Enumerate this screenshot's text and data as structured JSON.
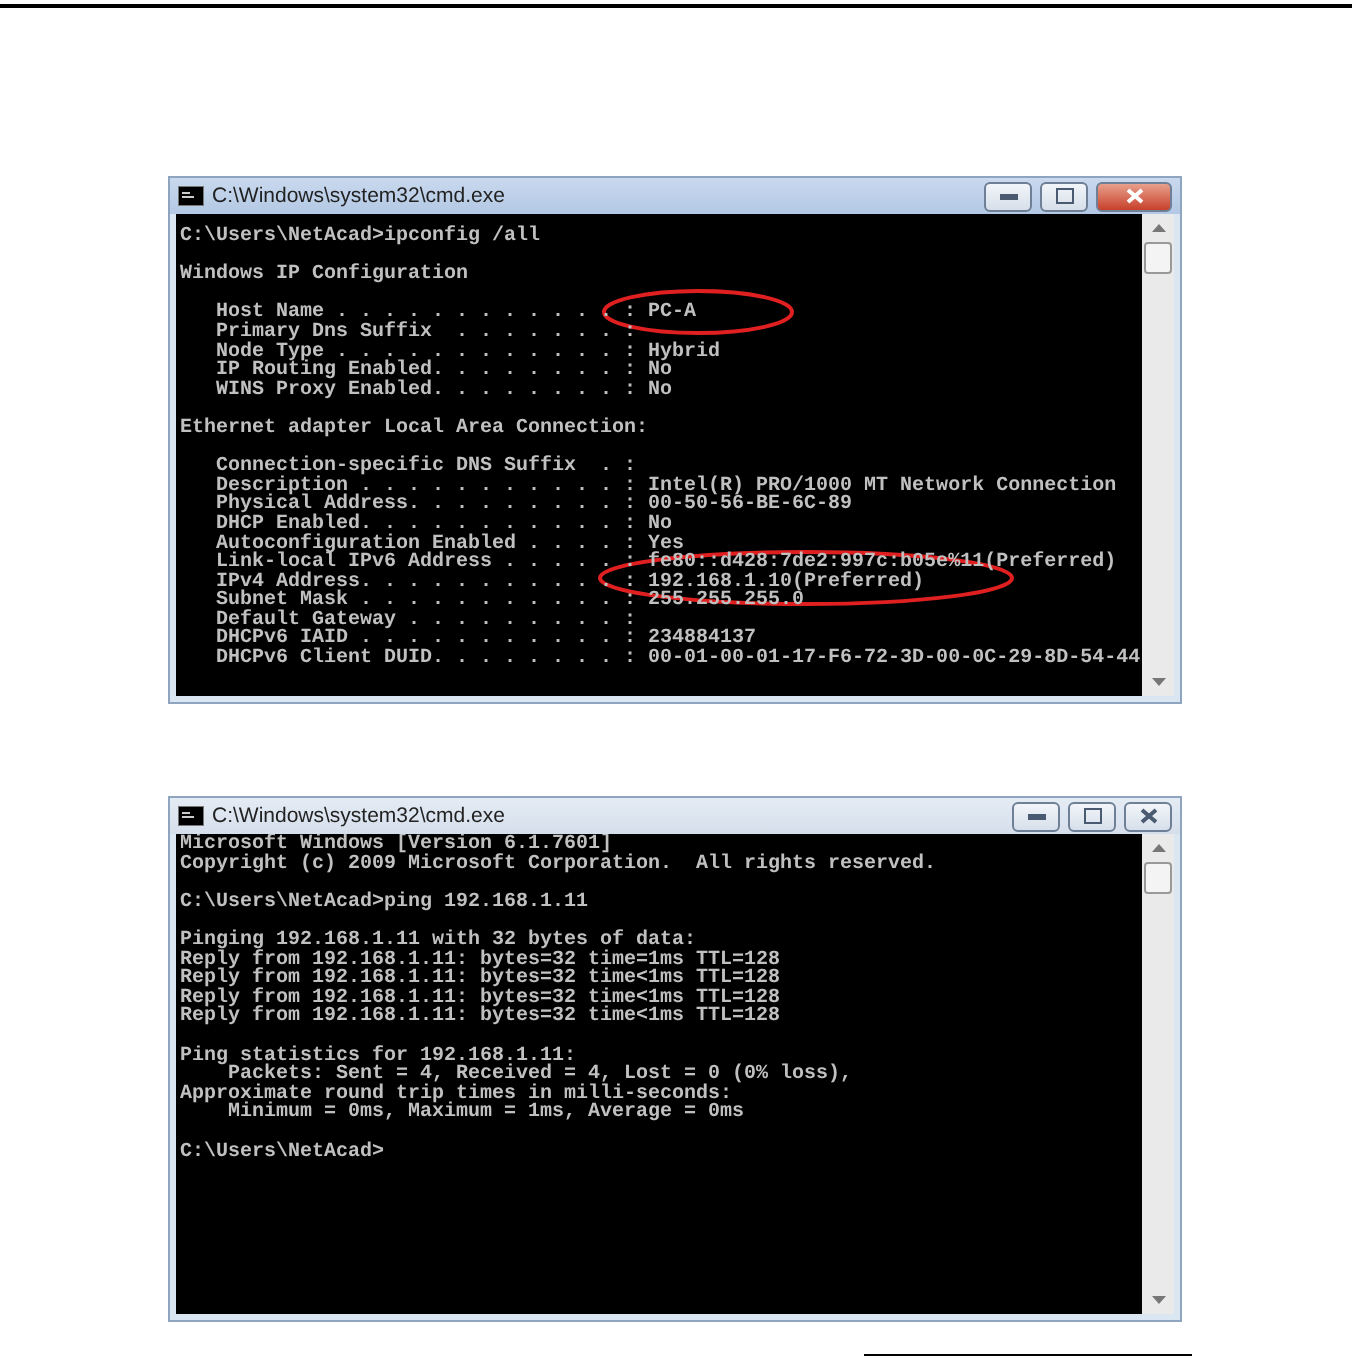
{
  "windows": [
    {
      "title": "C:\\Windows\\system32\\cmd.exe",
      "active": true,
      "blocks": [
        [
          "C:\\Users\\NetAcad>ipconfig /all"
        ],
        [
          "Windows IP Configuration"
        ],
        [
          "   Host Name . . . . . . . . . . . . : PC-A",
          "   Primary Dns Suffix  . . . . . . . :",
          "   Node Type . . . . . . . . . . . . : Hybrid",
          "   IP Routing Enabled. . . . . . . . : No",
          "   WINS Proxy Enabled. . . . . . . . : No"
        ],
        [
          "Ethernet adapter Local Area Connection:"
        ],
        [
          "   Connection-specific DNS Suffix  . :",
          "   Description . . . . . . . . . . . : Intel(R) PRO/1000 MT Network Connection",
          "   Physical Address. . . . . . . . . : 00-50-56-BE-6C-89",
          "   DHCP Enabled. . . . . . . . . . . : No",
          "   Autoconfiguration Enabled . . . . : Yes",
          "   Link-local IPv6 Address . . . . . : fe80::d428:7de2:997c:b05e%11(Preferred)",
          "   IPv4 Address. . . . . . . . . . . : 192.168.1.10(Preferred)",
          "   Subnet Mask . . . . . . . . . . . : 255.255.255.0",
          "   Default Gateway . . . . . . . . . :",
          "   DHCPv6 IAID . . . . . . . . . . . : 234884137",
          "   DHCPv6 Client DUID. . . . . . . . : 00-01-00-01-17-F6-72-3D-00-0C-29-8D-54-44"
        ]
      ]
    },
    {
      "title": "C:\\Windows\\system32\\cmd.exe",
      "active": false,
      "blocks": [
        [
          "Microsoft Windows [Version 6.1.7601]",
          "Copyright (c) 2009 Microsoft Corporation.  All rights reserved."
        ],
        [
          "C:\\Users\\NetAcad>ping 192.168.1.11"
        ],
        [
          "Pinging 192.168.1.11 with 32 bytes of data:",
          "Reply from 192.168.1.11: bytes=32 time=1ms TTL=128",
          "Reply from 192.168.1.11: bytes=32 time<1ms TTL=128",
          "Reply from 192.168.1.11: bytes=32 time<1ms TTL=128",
          "Reply from 192.168.1.11: bytes=32 time<1ms TTL=128"
        ],
        [
          "Ping statistics for 192.168.1.11:",
          "    Packets: Sent = 4, Received = 4, Lost = 0 (0% loss),",
          "Approximate round trip times in milli-seconds:",
          "    Minimum = 0ms, Maximum = 1ms, Average = 0ms"
        ],
        [
          "C:\\Users\\NetAcad>"
        ]
      ]
    }
  ]
}
